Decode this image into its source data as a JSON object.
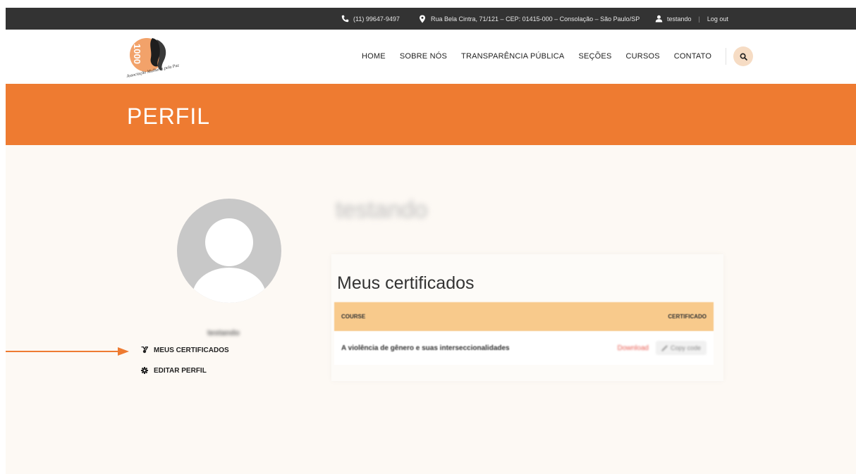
{
  "topbar": {
    "phone": "(11) 99647-9497",
    "address": "Rua Bela Cintra, 71/121 – CEP: 01415-000 – Consolação – São Paulo/SP",
    "user": "testando",
    "separator": "|",
    "logout": "Log out",
    "icons": {
      "phone": "phone-icon",
      "address": "map-pin-icon",
      "user": "user-icon"
    }
  },
  "logo": {
    "number": "1000",
    "text": "Associação Mulheres pela Paz"
  },
  "nav": {
    "items": [
      "HOME",
      "SOBRE NÓS",
      "TRANSPARÊNCIA PÚBLICA",
      "SEÇÕES",
      "CURSOS",
      "CONTATO"
    ],
    "search_icon": "search-icon"
  },
  "page": {
    "title": "PERFIL"
  },
  "profile": {
    "username": "testando"
  },
  "side_menu": {
    "items": [
      {
        "label": "MEUS CERTIFICADOS",
        "icon": "medal-icon"
      },
      {
        "label": "EDITAR PERFIL",
        "icon": "gear-icon"
      }
    ]
  },
  "certificates": {
    "title": "Meus certificados",
    "columns": [
      "COURSE",
      "CERTIFICADO"
    ],
    "rows": [
      {
        "course": "A violência de gênero e suas interseccionalidades",
        "download": "Download",
        "copy": "Copy code"
      }
    ]
  },
  "colors": {
    "accent": "#ee7b31",
    "topbar": "#333333",
    "table_header": "#f8ca8c",
    "page_background": "#fdf9f4",
    "download_link": "#e85a4f"
  }
}
